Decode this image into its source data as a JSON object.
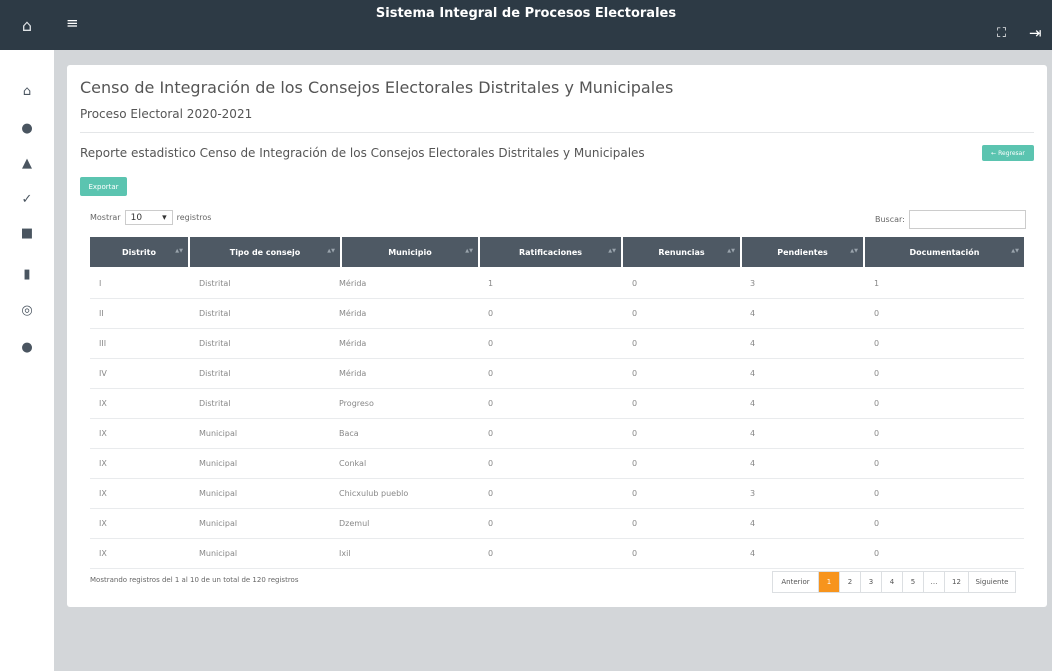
{
  "app": {
    "title": "Sistema Integral de Procesos Electorales",
    "home_icon": "⌂",
    "menu_icon": "≡",
    "expand_icon": "⛶",
    "logout_icon": "⇥"
  },
  "sidebar": {
    "icons": [
      {
        "name": "home-icon",
        "glyph": "⌂"
      },
      {
        "name": "user-group-icon",
        "glyph": "●"
      },
      {
        "name": "users-icon",
        "glyph": "▲"
      },
      {
        "name": "check-icon",
        "glyph": "✓"
      },
      {
        "name": "team-icon",
        "glyph": "■"
      },
      {
        "name": "bar-chart-icon",
        "glyph": "▮"
      },
      {
        "name": "eye-icon",
        "glyph": "◎"
      },
      {
        "name": "cog-icon",
        "glyph": "●"
      }
    ]
  },
  "page": {
    "heading": "Censo de Integración de los Consejos Electorales Distritales y Municipales",
    "process": "Proceso Electoral 2020-2021",
    "report_title": "Reporte estadistico Censo de Integración de los Consejos Electorales Distritales y Municipales",
    "back_button": "← Regresar",
    "export_button": "Exportar"
  },
  "table_controls": {
    "show_label": "Mostrar",
    "page_size": "10",
    "records_label": "registros",
    "search_label": "Buscar:",
    "search_value": ""
  },
  "table": {
    "columns": [
      "Distrito",
      "Tipo de consejo",
      "Municipio",
      "Ratificaciones",
      "Renuncias",
      "Pendientes",
      "Documentación"
    ],
    "rows": [
      [
        "I",
        "Distrital",
        "Mérida",
        "1",
        "0",
        "3",
        "1"
      ],
      [
        "II",
        "Distrital",
        "Mérida",
        "0",
        "0",
        "4",
        "0"
      ],
      [
        "III",
        "Distrital",
        "Mérida",
        "0",
        "0",
        "4",
        "0"
      ],
      [
        "IV",
        "Distrital",
        "Mérida",
        "0",
        "0",
        "4",
        "0"
      ],
      [
        "IX",
        "Distrital",
        "Progreso",
        "0",
        "0",
        "4",
        "0"
      ],
      [
        "IX",
        "Municipal",
        "Baca",
        "0",
        "0",
        "4",
        "0"
      ],
      [
        "IX",
        "Municipal",
        "Conkal",
        "0",
        "0",
        "4",
        "0"
      ],
      [
        "IX",
        "Municipal",
        "Chicxulub pueblo",
        "0",
        "0",
        "3",
        "0"
      ],
      [
        "IX",
        "Municipal",
        "Dzemul",
        "0",
        "0",
        "4",
        "0"
      ],
      [
        "IX",
        "Municipal",
        "Ixil",
        "0",
        "0",
        "4",
        "0"
      ]
    ]
  },
  "footer": {
    "info": "Mostrando registros del 1 al 10 de un total de 120 registros",
    "pagination": [
      "Anterior",
      "1",
      "2",
      "3",
      "4",
      "5",
      "…",
      "12",
      "Siguiente"
    ],
    "active_page": "1"
  },
  "colors": {
    "topbar": "#2d3a45",
    "accent": "#5bc4b0",
    "table_header": "#4e5964",
    "active_page": "#f7941d"
  }
}
